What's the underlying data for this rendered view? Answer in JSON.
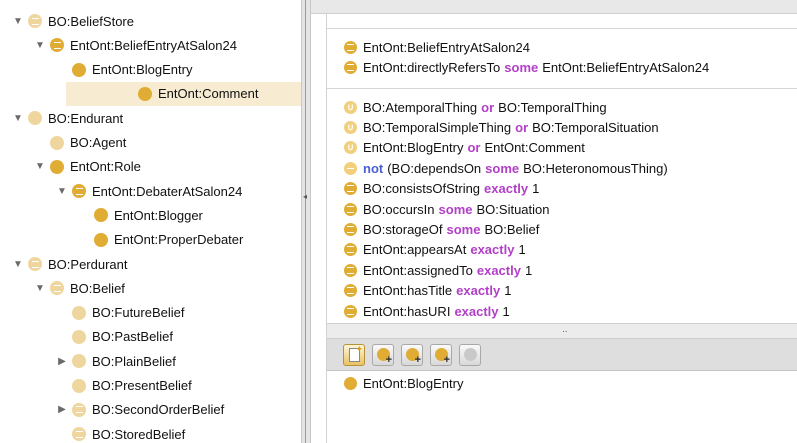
{
  "tree": [
    {
      "label": "BO:BeliefStore",
      "indent": 0,
      "toggle": "open",
      "icon": "eq-light",
      "selected": false
    },
    {
      "label": "EntOnt:BeliefEntryAtSalon24",
      "indent": 1,
      "toggle": "open",
      "icon": "eq-dark",
      "selected": false
    },
    {
      "label": "EntOnt:BlogEntry",
      "indent": 2,
      "toggle": "none",
      "icon": "dark",
      "selected": false
    },
    {
      "label": "EntOnt:Comment",
      "indent": 2,
      "toggle": "none",
      "icon": "dark",
      "selected": true
    },
    {
      "label": "BO:Endurant",
      "indent": 0,
      "toggle": "open",
      "icon": "light",
      "selected": false
    },
    {
      "label": "BO:Agent",
      "indent": 1,
      "toggle": "none",
      "icon": "light",
      "selected": false
    },
    {
      "label": "EntOnt:Role",
      "indent": 1,
      "toggle": "open",
      "icon": "dark",
      "selected": false
    },
    {
      "label": "EntOnt:DebaterAtSalon24",
      "indent": 2,
      "toggle": "open",
      "icon": "eq-dark",
      "selected": false
    },
    {
      "label": "EntOnt:Blogger",
      "indent": 3,
      "toggle": "none",
      "icon": "dark",
      "selected": false
    },
    {
      "label": "EntOnt:ProperDebater",
      "indent": 3,
      "toggle": "none",
      "icon": "dark",
      "selected": false
    },
    {
      "label": "BO:Perdurant",
      "indent": 0,
      "toggle": "open",
      "icon": "eq-light",
      "selected": false
    },
    {
      "label": "BO:Belief",
      "indent": 1,
      "toggle": "open",
      "icon": "eq-light",
      "selected": false
    },
    {
      "label": "BO:FutureBelief",
      "indent": 2,
      "toggle": "none",
      "icon": "light",
      "selected": false
    },
    {
      "label": "BO:PastBelief",
      "indent": 2,
      "toggle": "none",
      "icon": "light",
      "selected": false
    },
    {
      "label": "BO:PlainBelief",
      "indent": 2,
      "toggle": "closed",
      "icon": "light",
      "selected": false
    },
    {
      "label": "BO:PresentBelief",
      "indent": 2,
      "toggle": "none",
      "icon": "light",
      "selected": false
    },
    {
      "label": "BO:SecondOrderBelief",
      "indent": 2,
      "toggle": "closed",
      "icon": "eq-light",
      "selected": false
    },
    {
      "label": "BO:StoredBelief",
      "indent": 2,
      "toggle": "none",
      "icon": "eq-light",
      "selected": false
    }
  ],
  "equivalent": [
    {
      "icon": "eq",
      "parts": [
        {
          "t": "EntOnt:BeliefEntryAtSalon24"
        }
      ]
    },
    {
      "icon": "eq",
      "parts": [
        {
          "t": "EntOnt:directlyRefersTo"
        },
        {
          "t": "some",
          "kw": "purple"
        },
        {
          "t": "EntOnt:BeliefEntryAtSalon24"
        }
      ]
    }
  ],
  "superclasses": [
    {
      "icon": "u",
      "parts": [
        {
          "t": "BO:AtemporalThing"
        },
        {
          "t": "or",
          "kw": "purple"
        },
        {
          "t": "BO:TemporalThing"
        }
      ]
    },
    {
      "icon": "u",
      "parts": [
        {
          "t": "BO:TemporalSimpleThing"
        },
        {
          "t": "or",
          "kw": "purple"
        },
        {
          "t": "BO:TemporalSituation"
        }
      ]
    },
    {
      "icon": "u",
      "parts": [
        {
          "t": "EntOnt:BlogEntry"
        },
        {
          "t": "or",
          "kw": "purple"
        },
        {
          "t": "EntOnt:Comment"
        }
      ]
    },
    {
      "icon": "dash",
      "parts": [
        {
          "t": "not",
          "kw": "blue"
        },
        {
          "t": "(BO:dependsOn"
        },
        {
          "t": "some",
          "kw": "purple"
        },
        {
          "t": "BO:HeteronomousThing)"
        }
      ]
    },
    {
      "icon": "eq",
      "parts": [
        {
          "t": "BO:consistsOfString"
        },
        {
          "t": "exactly",
          "kw": "purple"
        },
        {
          "t": "1"
        }
      ]
    },
    {
      "icon": "eq",
      "parts": [
        {
          "t": "BO:occursIn"
        },
        {
          "t": "some",
          "kw": "purple"
        },
        {
          "t": "BO:Situation"
        }
      ]
    },
    {
      "icon": "eq",
      "parts": [
        {
          "t": "BO:storageOf"
        },
        {
          "t": "some",
          "kw": "purple"
        },
        {
          "t": "BO:Belief"
        }
      ]
    },
    {
      "icon": "eq",
      "parts": [
        {
          "t": "EntOnt:appearsAt"
        },
        {
          "t": "exactly",
          "kw": "purple"
        },
        {
          "t": "1"
        }
      ]
    },
    {
      "icon": "eq",
      "parts": [
        {
          "t": "EntOnt:assignedTo"
        },
        {
          "t": "exactly",
          "kw": "purple"
        },
        {
          "t": "1"
        }
      ]
    },
    {
      "icon": "eq",
      "parts": [
        {
          "t": "EntOnt:hasTitle"
        },
        {
          "t": "exactly",
          "kw": "purple"
        },
        {
          "t": "1"
        }
      ]
    },
    {
      "icon": "eq",
      "parts": [
        {
          "t": "EntOnt:hasURI"
        },
        {
          "t": "exactly",
          "kw": "purple"
        },
        {
          "t": "1"
        }
      ]
    }
  ],
  "toolbar": [
    {
      "name": "create-class-button",
      "state": "active"
    },
    {
      "name": "add-subclass-button",
      "state": "normal"
    },
    {
      "name": "add-sibling-button",
      "state": "normal"
    },
    {
      "name": "merge-class-button",
      "state": "normal"
    },
    {
      "name": "delete-class-button",
      "state": "disabled"
    }
  ],
  "divider_dots": "..",
  "subclass_item": "EntOnt:BlogEntry",
  "colors": {
    "accent_dark": "#e0ac34",
    "accent_light": "#efd69f",
    "keyword_purple": "#b23fc7",
    "keyword_blue": "#4a5fd2",
    "selection": "#f7ebd2"
  }
}
